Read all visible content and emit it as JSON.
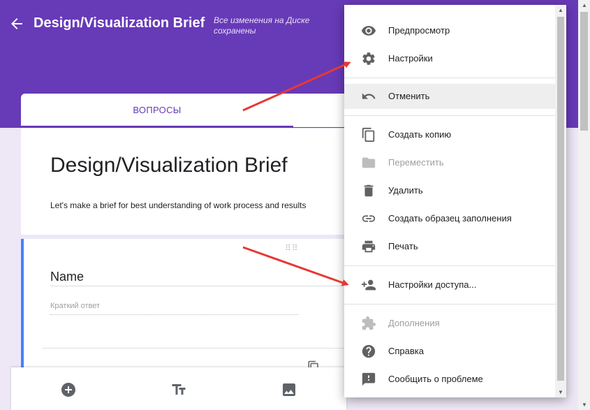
{
  "header": {
    "title": "Design/Visualization Brief",
    "saved_status": "Все изменения на Диске сохранены",
    "color": "#673ab7"
  },
  "tabs": {
    "questions_label": "ВОПРОСЫ"
  },
  "form": {
    "title": "Design/Visualization Brief",
    "description": "Let's make a brief for best understanding of work process and results"
  },
  "question": {
    "title": "Name",
    "answer_placeholder": "Краткий ответ"
  },
  "toolbar": {
    "icons": [
      "add-circle-icon",
      "text-format-icon",
      "image-icon"
    ]
  },
  "menu": {
    "items": [
      {
        "label": "Предпросмотр",
        "icon": "eye-icon",
        "disabled": false
      },
      {
        "label": "Настройки",
        "icon": "gear-icon",
        "disabled": false
      },
      {
        "label": "Отменить",
        "icon": "undo-icon",
        "disabled": false,
        "highlighted": true
      },
      {
        "label": "Создать копию",
        "icon": "copy-icon",
        "disabled": false
      },
      {
        "label": "Переместить",
        "icon": "folder-icon",
        "disabled": true
      },
      {
        "label": "Удалить",
        "icon": "trash-icon",
        "disabled": false
      },
      {
        "label": "Создать образец заполнения",
        "icon": "link-icon",
        "disabled": false
      },
      {
        "label": "Печать",
        "icon": "print-icon",
        "disabled": false
      },
      {
        "label": "Настройки доступа...",
        "icon": "add-people-icon",
        "disabled": false
      },
      {
        "label": "Дополнения",
        "icon": "puzzle-icon",
        "disabled": true
      },
      {
        "label": "Справка",
        "icon": "help-icon",
        "disabled": false
      },
      {
        "label": "Сообщить о проблеме",
        "icon": "feedback-icon",
        "disabled": false
      }
    ]
  },
  "annotation_color": "#e53935"
}
